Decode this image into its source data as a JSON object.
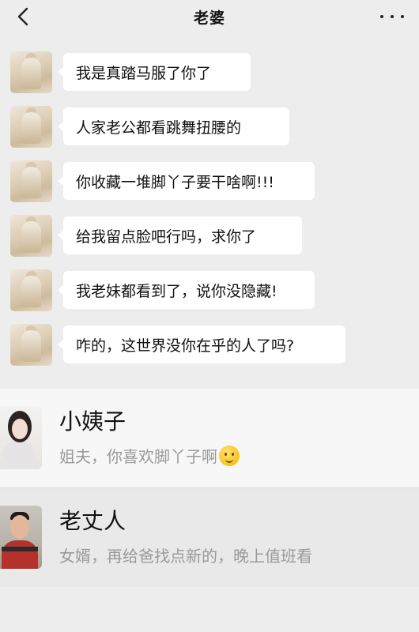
{
  "header": {
    "title": "老婆",
    "back_icon": "chevron-left-icon",
    "more_icon": "more-dots-icon"
  },
  "messages": [
    {
      "text": "我是真踏马服了你了"
    },
    {
      "text": "人家老公都看跳舞扭腰的"
    },
    {
      "text": "你收藏一堆脚丫子要干啥啊!!!"
    },
    {
      "text": "给我留点脸吧行吗，求你了"
    },
    {
      "text": "我老妹都看到了，说你没隐藏!"
    },
    {
      "text": "咋的，这世界没你在乎的人了吗?"
    }
  ],
  "cards": [
    {
      "name": "小姨子",
      "message": "姐夫，你喜欢脚丫子啊",
      "emoji": "thinking-face-emoji"
    },
    {
      "name": "老丈人",
      "message": "女婿，再给爸找点新的，晚上值班看"
    }
  ],
  "colors": {
    "background": "#ededed",
    "bubble": "#ffffff",
    "card_highlight": "#e9e9e9",
    "subtext": "#9a9a9a"
  }
}
